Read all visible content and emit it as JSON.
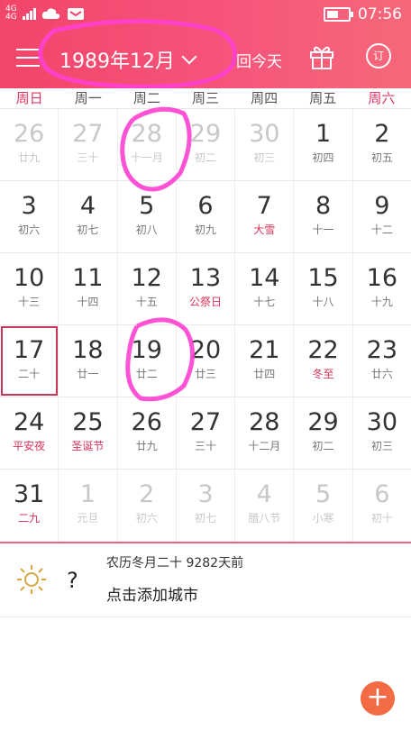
{
  "status": {
    "net1": "4G",
    "net2": "4G",
    "time": "07:56"
  },
  "toolbar": {
    "month_title": "1989年12月",
    "today_label": "回今天",
    "sub_label": "订"
  },
  "weekdays": [
    "周日",
    "周一",
    "周二",
    "周三",
    "周四",
    "周五",
    "周六"
  ],
  "calendar": {
    "rows": [
      [
        {
          "d": "26",
          "l": "廿九",
          "other": true
        },
        {
          "d": "27",
          "l": "三十",
          "other": true
        },
        {
          "d": "28",
          "l": "十一月",
          "other": true
        },
        {
          "d": "29",
          "l": "初二",
          "other": true
        },
        {
          "d": "30",
          "l": "初三",
          "other": true
        },
        {
          "d": "1",
          "l": "初四"
        },
        {
          "d": "2",
          "l": "初五"
        }
      ],
      [
        {
          "d": "3",
          "l": "初六"
        },
        {
          "d": "4",
          "l": "初七"
        },
        {
          "d": "5",
          "l": "初八"
        },
        {
          "d": "6",
          "l": "初九"
        },
        {
          "d": "7",
          "l": "大雪",
          "fest": true
        },
        {
          "d": "8",
          "l": "十一"
        },
        {
          "d": "9",
          "l": "十二"
        }
      ],
      [
        {
          "d": "10",
          "l": "十三"
        },
        {
          "d": "11",
          "l": "十四"
        },
        {
          "d": "12",
          "l": "十五"
        },
        {
          "d": "13",
          "l": "公祭日",
          "fest": true
        },
        {
          "d": "14",
          "l": "十七"
        },
        {
          "d": "15",
          "l": "十八"
        },
        {
          "d": "16",
          "l": "十九"
        }
      ],
      [
        {
          "d": "17",
          "l": "二十",
          "selected": true
        },
        {
          "d": "18",
          "l": "廿一"
        },
        {
          "d": "19",
          "l": "廿二"
        },
        {
          "d": "20",
          "l": "廿三"
        },
        {
          "d": "21",
          "l": "廿四"
        },
        {
          "d": "22",
          "l": "冬至",
          "fest": true
        },
        {
          "d": "23",
          "l": "廿六"
        }
      ],
      [
        {
          "d": "24",
          "l": "平安夜",
          "fest": true
        },
        {
          "d": "25",
          "l": "圣诞节",
          "fest": true
        },
        {
          "d": "26",
          "l": "廿九"
        },
        {
          "d": "27",
          "l": "三十"
        },
        {
          "d": "28",
          "l": "十二月"
        },
        {
          "d": "29",
          "l": "初二"
        },
        {
          "d": "30",
          "l": "初三"
        }
      ],
      [
        {
          "d": "31",
          "l": "二九",
          "fest": true
        },
        {
          "d": "1",
          "l": "元旦",
          "other": true
        },
        {
          "d": "2",
          "l": "初六",
          "other": true
        },
        {
          "d": "3",
          "l": "初七",
          "other": true
        },
        {
          "d": "4",
          "l": "腊八节",
          "other": true,
          "fest": true
        },
        {
          "d": "5",
          "l": "小寒",
          "other": true,
          "fest": true
        },
        {
          "d": "6",
          "l": "初十",
          "other": true
        }
      ]
    ]
  },
  "info": {
    "weather_unknown": "?",
    "lunar_text": "农历冬月二十 9282天前",
    "city_prompt": "点击添加城市"
  },
  "fab": {
    "label": "+"
  },
  "colors": {
    "accent": "#f2456a",
    "festival": "#d8345a",
    "weekend": "#e03560",
    "annotation": "#ff40d0"
  }
}
